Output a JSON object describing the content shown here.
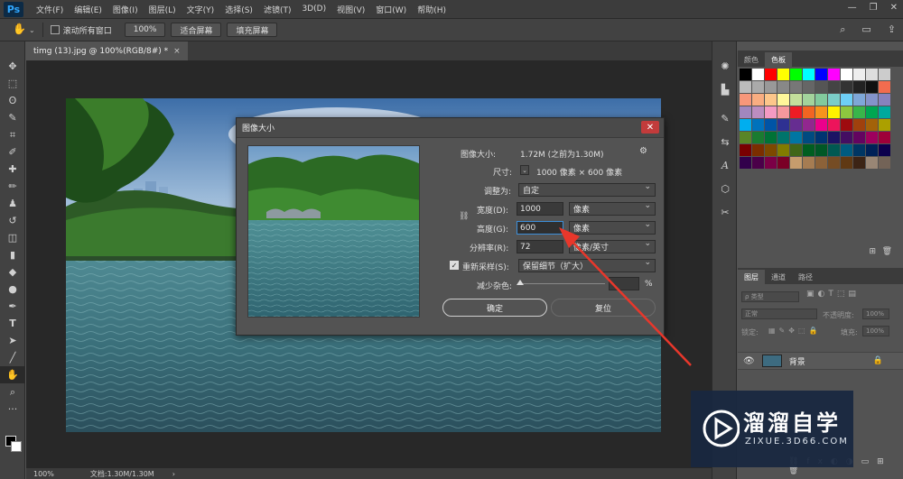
{
  "app": {
    "logo": "Ps",
    "menu": [
      "文件(F)",
      "编辑(E)",
      "图像(I)",
      "图层(L)",
      "文字(Y)",
      "选择(S)",
      "滤镜(T)",
      "3D(D)",
      "视图(V)",
      "窗口(W)",
      "帮助(H)"
    ],
    "window_controls": [
      "—",
      "❐",
      "✕"
    ]
  },
  "options_bar": {
    "scroll_all_label": "滚动所有窗口",
    "zoom_100": "100%",
    "fit_screen": "适合屏幕",
    "fill_screen": "填充屏幕"
  },
  "document": {
    "tab_title": "timg (13).jpg @ 100%(RGB/8#) *",
    "status_zoom": "100%",
    "status_doc": "文档:1.30M/1.30M"
  },
  "dialog": {
    "title": "图像大小",
    "image_size_label": "图像大小:",
    "image_size_value": "1.72M (之前为1.30M)",
    "dimensions_label": "尺寸:",
    "dimensions_value": "1000 像素 × 600 像素",
    "fit_to_label": "调整为:",
    "fit_to_value": "自定",
    "width_label": "宽度(D):",
    "width_value": "1000",
    "width_unit": "像素",
    "height_label": "高度(G):",
    "height_value": "600",
    "height_unit": "像素",
    "resolution_label": "分辨率(R):",
    "resolution_value": "72",
    "resolution_unit": "像素/英寸",
    "resample_label": "重新采样(S):",
    "resample_value": "保留细节（扩大）",
    "noise_label": "减少杂色:",
    "noise_unit": "%",
    "ok": "确定",
    "reset": "复位"
  },
  "panels": {
    "swatch_tabs": [
      "颜色",
      "色板"
    ],
    "layer_tabs": [
      "图层",
      "通道",
      "路径"
    ],
    "kind_filter": "ρ 类型",
    "blend_mode": "正常",
    "opacity_label": "不透明度:",
    "opacity_value": "100%",
    "lock_label": "锁定:",
    "fill_label": "填充:",
    "fill_value": "100%",
    "layer_name": "背景",
    "swatch_colors": [
      "#000000",
      "#ffffff",
      "#ff0000",
      "#ffff00",
      "#00ff00",
      "#00ffff",
      "#0000ff",
      "#ff00ff",
      "#ffffff",
      "#eeeeee",
      "#dddddd",
      "#cccccc",
      "#bbbbbb",
      "#aaaaaa",
      "#999999",
      "#888888",
      "#777777",
      "#666666",
      "#555555",
      "#444444",
      "#333333",
      "#222222",
      "#111111",
      "#f26c4f",
      "#f7977a",
      "#f9ad81",
      "#fdc68a",
      "#fff79a",
      "#c4df9b",
      "#a3d39c",
      "#82ca9d",
      "#7bcdc8",
      "#6ecff6",
      "#7ea7d8",
      "#8493ca",
      "#8882be",
      "#a187be",
      "#bc8dbf",
      "#f49ac2",
      "#f6989d",
      "#ed1c24",
      "#f26522",
      "#f7941d",
      "#fff200",
      "#8dc63f",
      "#39b54a",
      "#00a651",
      "#00a99d",
      "#00aeef",
      "#0072bc",
      "#0054a6",
      "#2e3192",
      "#662d91",
      "#92278f",
      "#ec008c",
      "#ed145b",
      "#9e0b0f",
      "#a0410d",
      "#a36209",
      "#aba000",
      "#598527",
      "#1a7b30",
      "#007236",
      "#00746b",
      "#0076a3",
      "#004b80",
      "#003471",
      "#1b1464",
      "#440e62",
      "#630460",
      "#9e005d",
      "#9e0039",
      "#790000",
      "#7b2e00",
      "#7d4900",
      "#827b00",
      "#406618",
      "#005e20",
      "#005826",
      "#005952",
      "#005b7f",
      "#003663",
      "#002157",
      "#0d004c",
      "#32004b",
      "#4b0049",
      "#7b0046",
      "#7a0026",
      "#c69c6d",
      "#a67c52",
      "#8c6239",
      "#754c24",
      "#603913",
      "#3c2415",
      "#998675",
      "#736357"
    ]
  },
  "watermark": {
    "title": "溜溜自学",
    "subtitle": "ZIXUE.3D66.COM"
  }
}
